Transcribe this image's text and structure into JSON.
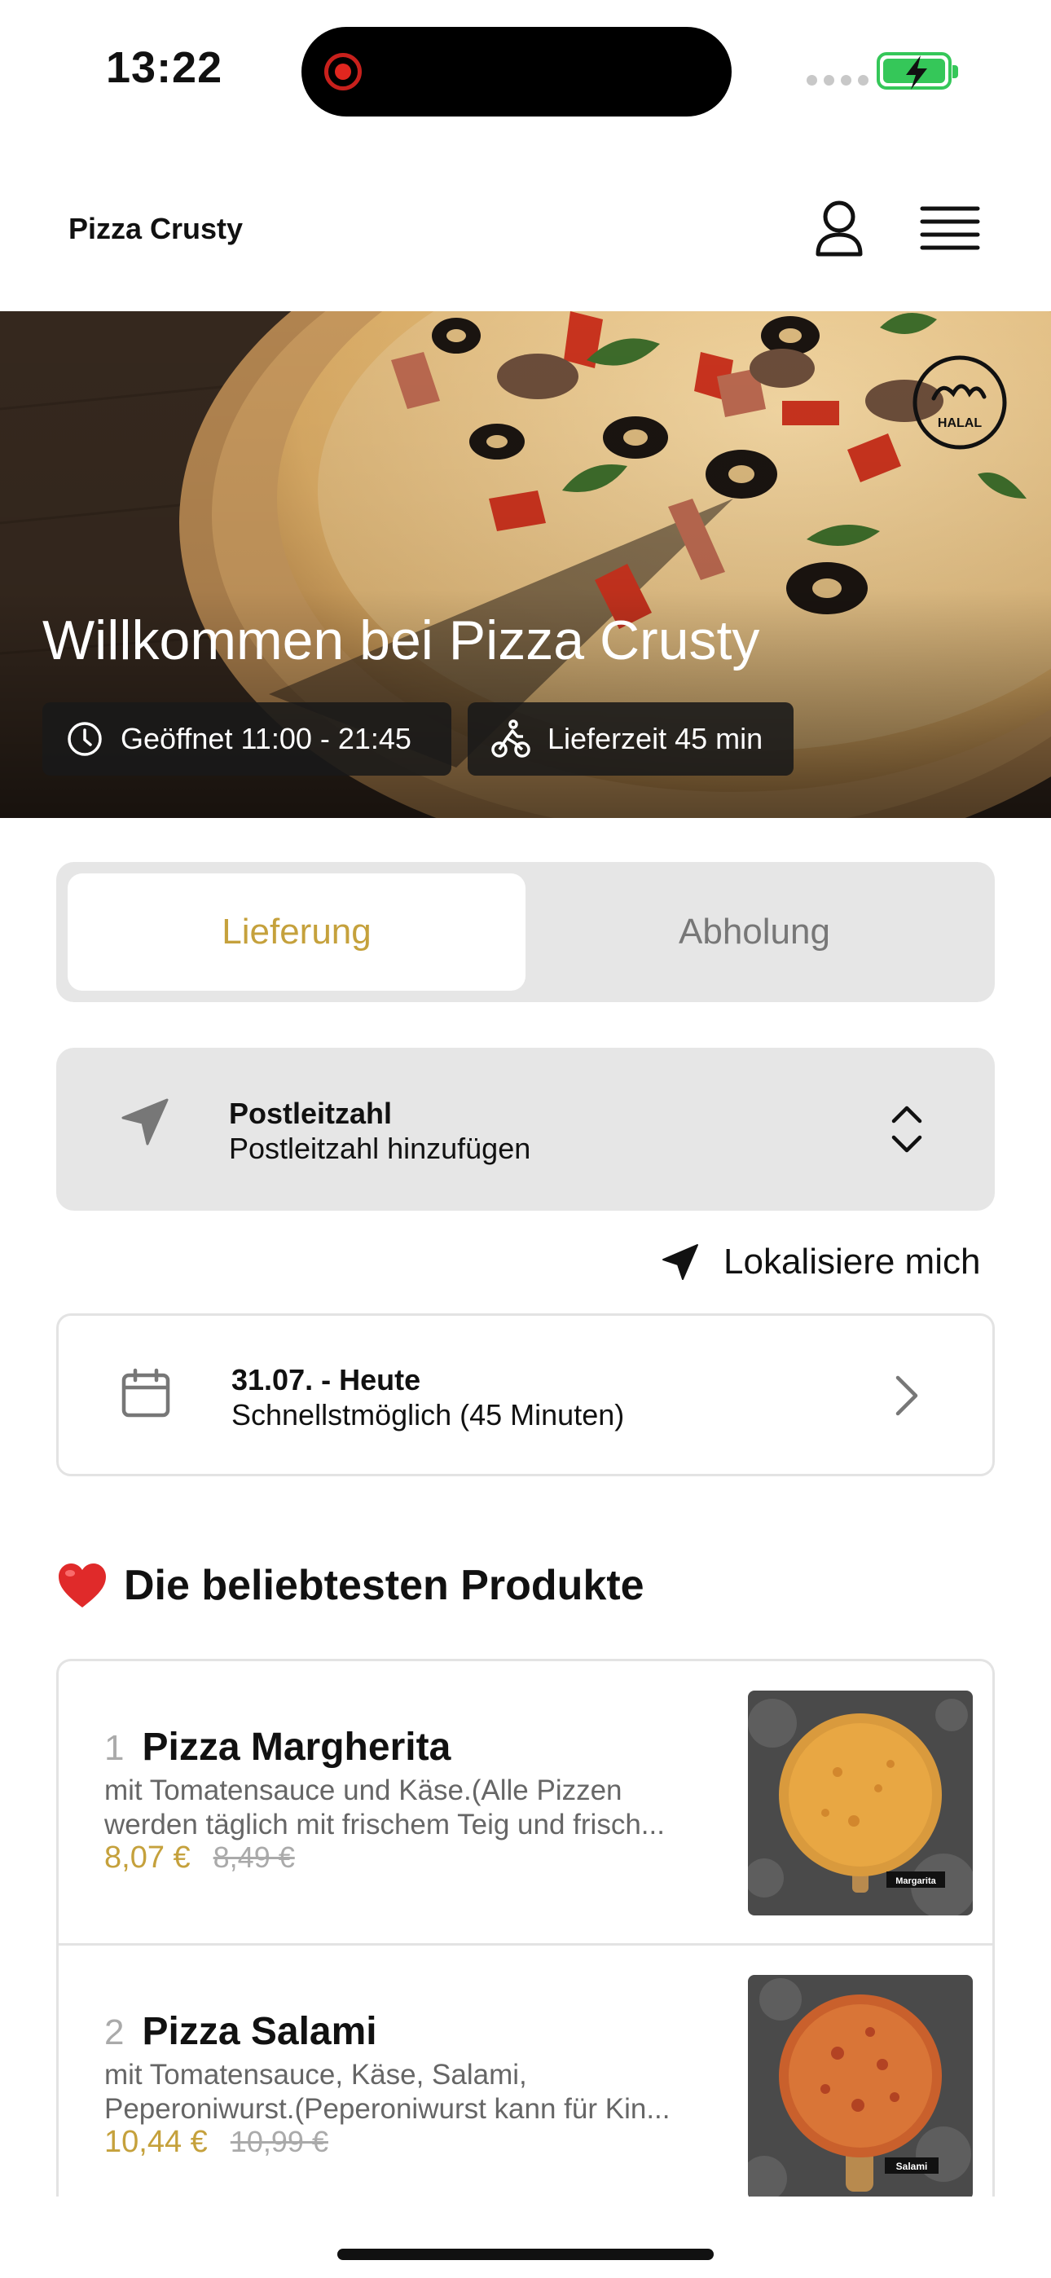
{
  "status_bar": {
    "time": "13:22"
  },
  "header": {
    "brand": "Pizza Crusty"
  },
  "hero": {
    "title": "Willkommen bei Pizza Crusty",
    "open_hours": "Geöffnet 11:00 - 21:45",
    "delivery_time": "Lieferzeit 45 min",
    "badge": "HALAL"
  },
  "order_mode": {
    "options": [
      "Lieferung",
      "Abholung"
    ],
    "selected": "Lieferung"
  },
  "postal": {
    "title": "Postleitzahl",
    "subtitle": "Postleitzahl hinzufügen"
  },
  "locate": {
    "label": "Lokalisiere mich"
  },
  "schedule": {
    "title": "31.07. - Heute",
    "subtitle": "Schnellstmöglich (45 Minuten)"
  },
  "popular": {
    "emoji": "❤️",
    "title": "Die beliebtesten Produkte",
    "products": [
      {
        "rank": "1",
        "name": "Pizza Margherita",
        "desc_line1": "mit Tomatensauce und Käse.(Alle Pizzen",
        "desc_line2": "werden täglich mit frischem Teig und frisch...",
        "price": "8,07 €",
        "old_price": "8,49 €",
        "image_label": "Margarita"
      },
      {
        "rank": "2",
        "name": "Pizza Salami",
        "desc_line1": "mit Tomatensauce, Käse, Salami,",
        "desc_line2": "Peperoniwurst.(Peperoniwurst kann für Kin...",
        "price": "10,44 €",
        "old_price": "10,99 €",
        "image_label": "Salami"
      }
    ]
  },
  "colors": {
    "accent": "#c5a13c",
    "card_bg": "#e6e6e6",
    "battery": "#35c759"
  }
}
